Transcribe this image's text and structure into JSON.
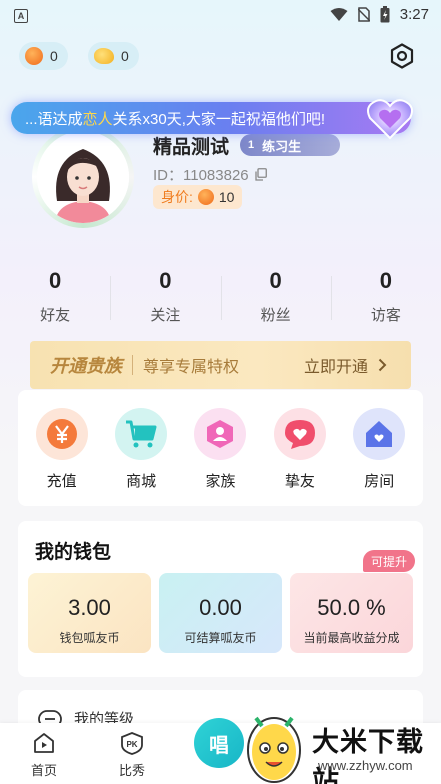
{
  "status_bar": {
    "time": "3:27",
    "app_badge": "A"
  },
  "wallet_pills": [
    {
      "icon": "coin-icon",
      "value": "0"
    },
    {
      "icon": "duck-coin-icon",
      "value": "0"
    }
  ],
  "notice": {
    "before": "...语达成",
    "highlight": "恋人",
    "after": "关系x30天,大家一起祝福他们吧!"
  },
  "profile": {
    "nickname": "精品测试",
    "level_num": "1",
    "level_title": "练习生",
    "id_text": "ID：11083826",
    "worth_label": "身价:",
    "worth_value": "10"
  },
  "stats": [
    {
      "value": "0",
      "label": "好友"
    },
    {
      "value": "0",
      "label": "关注"
    },
    {
      "value": "0",
      "label": "粉丝"
    },
    {
      "value": "0",
      "label": "访客"
    }
  ],
  "nobility": {
    "title": "开通贵族",
    "desc": "尊享专属特权",
    "action": "立即开通"
  },
  "features": [
    {
      "label": "充值",
      "icon": "yen-icon",
      "color": "#f47a3b"
    },
    {
      "label": "商城",
      "icon": "cart-icon",
      "color": "#23c2bf"
    },
    {
      "label": "家族",
      "icon": "family-icon",
      "color": "#f067b8"
    },
    {
      "label": "挚友",
      "icon": "heart-chat-icon",
      "color": "#f04e6c"
    },
    {
      "label": "房间",
      "icon": "home-icon",
      "color": "#5b74e8"
    }
  ],
  "wallet": {
    "title": "我的钱包",
    "withdraw_tag": "可提升",
    "boxes": [
      {
        "value": "3.00",
        "label": "钱包呱友币"
      },
      {
        "value": "0.00",
        "label": "可结算呱友币"
      },
      {
        "value": "50.0 %",
        "label": "当前最高收益分成"
      }
    ]
  },
  "level_row": {
    "label": "我的等级"
  },
  "bottom_nav": {
    "home": "首页",
    "pk": "比秀",
    "pk_badge": "PK",
    "sing": "唱"
  },
  "watermark": {
    "title": "大米下载站",
    "url": "www.zzhyw.com"
  }
}
